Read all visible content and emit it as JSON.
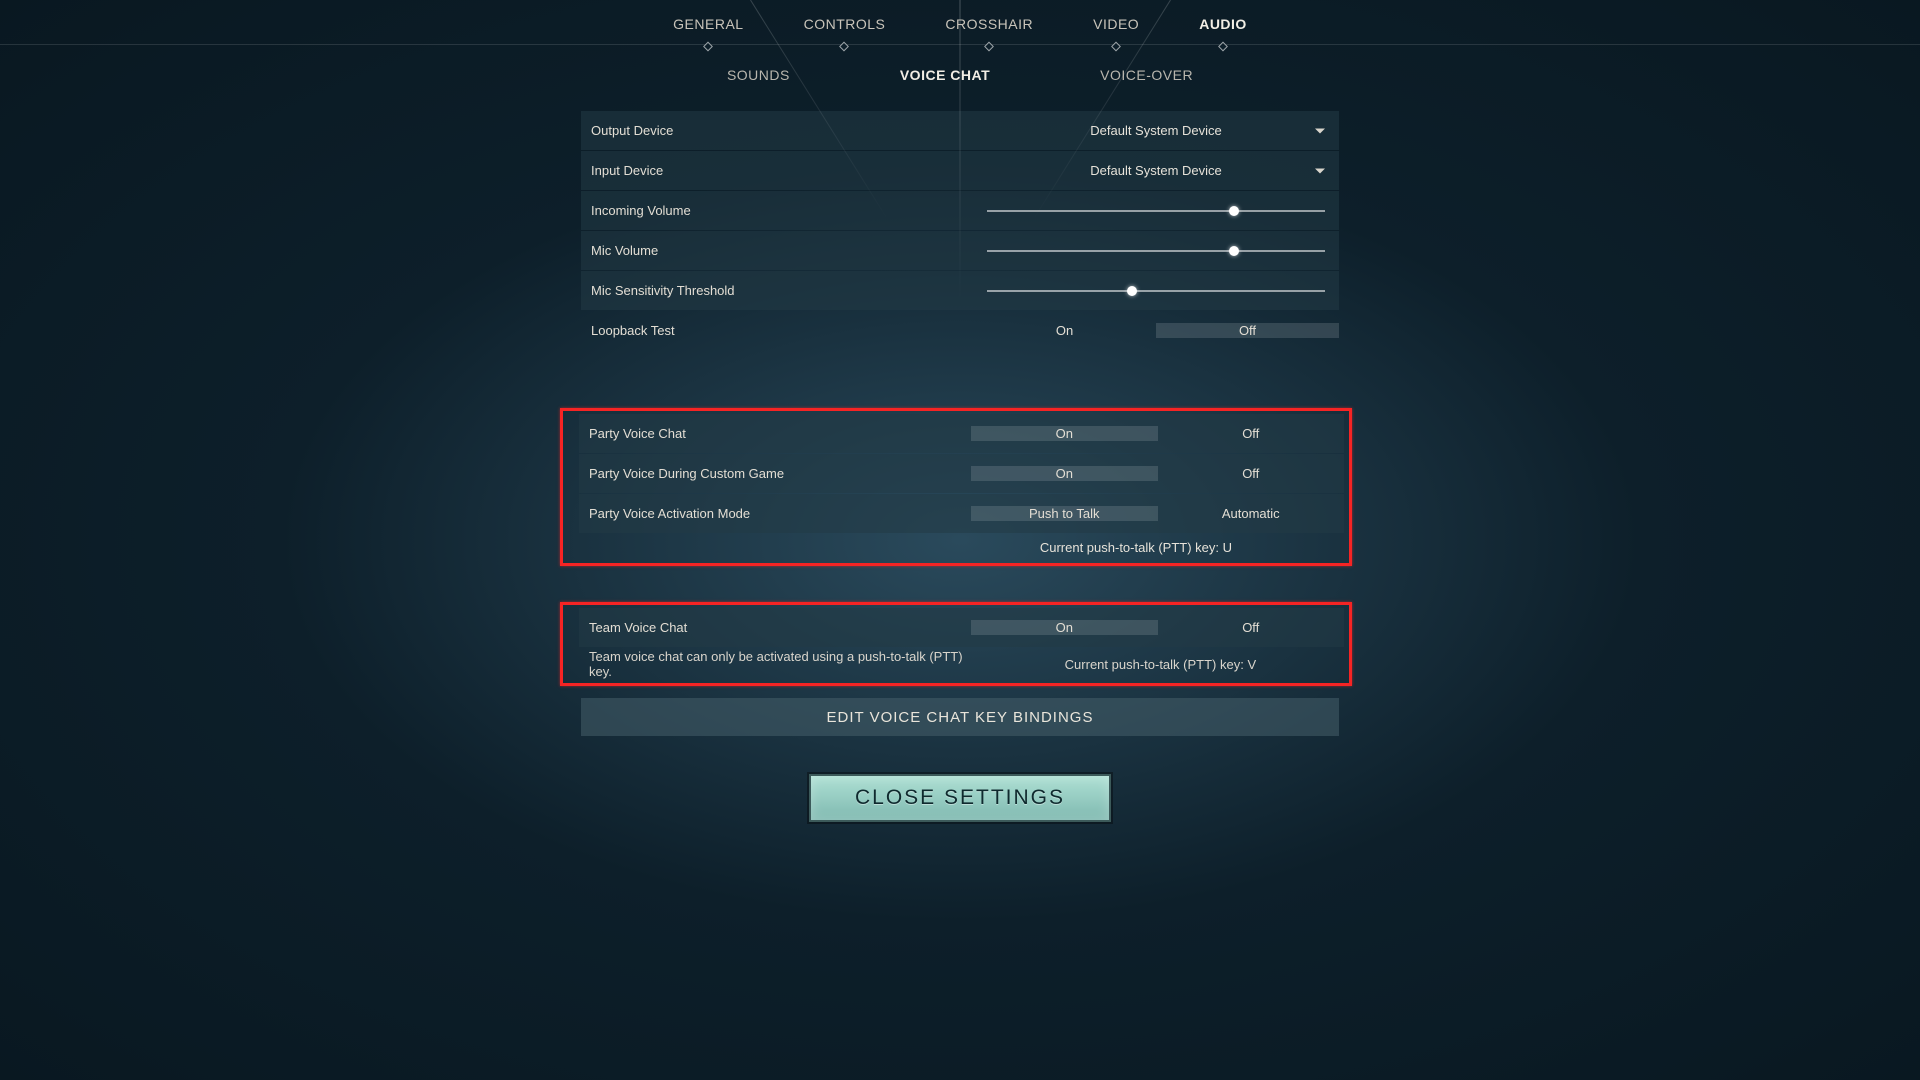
{
  "tabs_primary": {
    "general": "GENERAL",
    "controls": "CONTROLS",
    "crosshair": "CROSSHAIR",
    "video": "VIDEO",
    "audio": "AUDIO"
  },
  "tabs_sub": {
    "sounds": "SOUNDS",
    "voice_chat": "VOICE CHAT",
    "voice_over": "VOICE-OVER"
  },
  "audio": {
    "output_device": {
      "label": "Output Device",
      "value": "Default System Device"
    },
    "input_device": {
      "label": "Input Device",
      "value": "Default System Device"
    },
    "incoming_volume": {
      "label": "Incoming Volume",
      "pct": 73
    },
    "mic_volume": {
      "label": "Mic Volume",
      "pct": 73
    },
    "mic_sens": {
      "label": "Mic Sensitivity Threshold",
      "pct": 43
    },
    "loopback": {
      "label": "Loopback Test",
      "on": "On",
      "off": "Off",
      "selected": "off"
    }
  },
  "party": {
    "voice_chat": {
      "label": "Party Voice Chat",
      "on": "On",
      "off": "Off",
      "selected": "on"
    },
    "voice_custom": {
      "label": "Party Voice During Custom Game",
      "on": "On",
      "off": "Off",
      "selected": "on"
    },
    "activation": {
      "label": "Party Voice Activation Mode",
      "opt1": "Push to Talk",
      "opt2": "Automatic",
      "selected": "opt1"
    },
    "hint": "Current push-to-talk (PTT) key: U"
  },
  "team": {
    "voice_chat": {
      "label": "Team Voice Chat",
      "on": "On",
      "off": "Off",
      "selected": "on"
    },
    "hint_left": "Team voice chat can only be activated using a push-to-talk (PTT) key.",
    "hint_right": "Current push-to-talk (PTT) key: V"
  },
  "buttons": {
    "edit_keys": "EDIT VOICE CHAT KEY BINDINGS",
    "close": "CLOSE SETTINGS"
  }
}
